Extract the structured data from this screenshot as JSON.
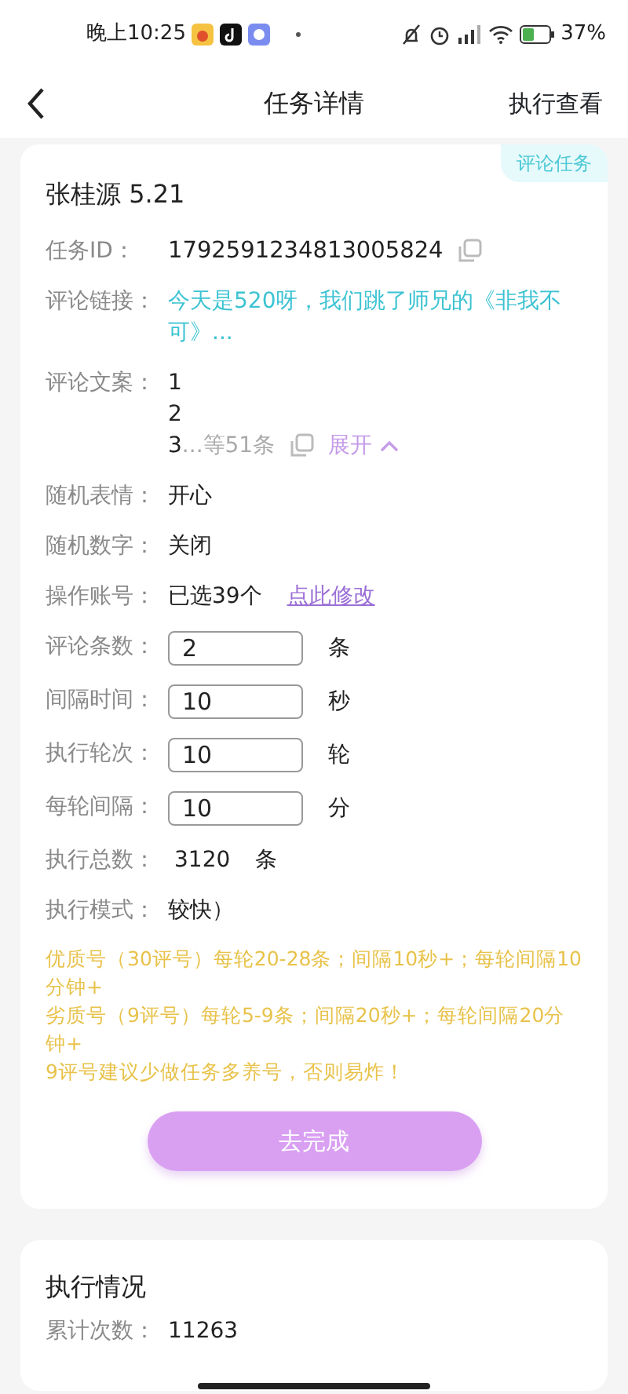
{
  "status_bar": {
    "time": "晚上10:25",
    "battery": "37%"
  },
  "header": {
    "title": "任务详情",
    "action": "执行查看"
  },
  "task": {
    "tag": "评论任务",
    "title": "张桂源 5.21",
    "fields": [
      {
        "kind": "copyable",
        "label": "任务ID：",
        "value": "1792591234813005824"
      },
      {
        "kind": "link",
        "label": "评论链接：",
        "value": "今天是520呀，我们跳了师兄的《非我不可》..."
      },
      {
        "kind": "lines",
        "label": "评论文案：",
        "lines": [
          "1",
          "2",
          "3"
        ],
        "more": "...等51条",
        "toggle": "展开"
      },
      {
        "kind": "text",
        "label": "随机表情：",
        "value": "开心"
      },
      {
        "kind": "text",
        "label": "随机数字：",
        "value": "关闭"
      },
      {
        "kind": "action",
        "label": "操作账号：",
        "value": "已选39个",
        "action": "点此修改"
      },
      {
        "kind": "input",
        "label": "评论条数：",
        "value": "2",
        "unit": "条"
      },
      {
        "kind": "input",
        "label": "间隔时间：",
        "value": "10",
        "unit": "秒"
      },
      {
        "kind": "input",
        "label": "执行轮次：",
        "value": "10",
        "unit": "轮"
      },
      {
        "kind": "input",
        "label": "每轮间隔：",
        "value": "10",
        "unit": "分"
      },
      {
        "kind": "unit",
        "label": "执行总数：",
        "value": "3120",
        "unit": "条"
      },
      {
        "kind": "text",
        "label": "执行模式：",
        "value": "较快）"
      }
    ],
    "notes": [
      "优质号（30评号）每轮20-28条；间隔10秒+；每轮间隔10分钟+",
      "劣质号（9评号）每轮5-9条；间隔20秒+；每轮间隔20分钟+",
      "9评号建议少做任务多养号，否则易炸！"
    ],
    "button": "去完成"
  },
  "execution": {
    "title": "执行情况",
    "fields": [
      {
        "label": "累计次数：",
        "value": "11263"
      }
    ]
  }
}
